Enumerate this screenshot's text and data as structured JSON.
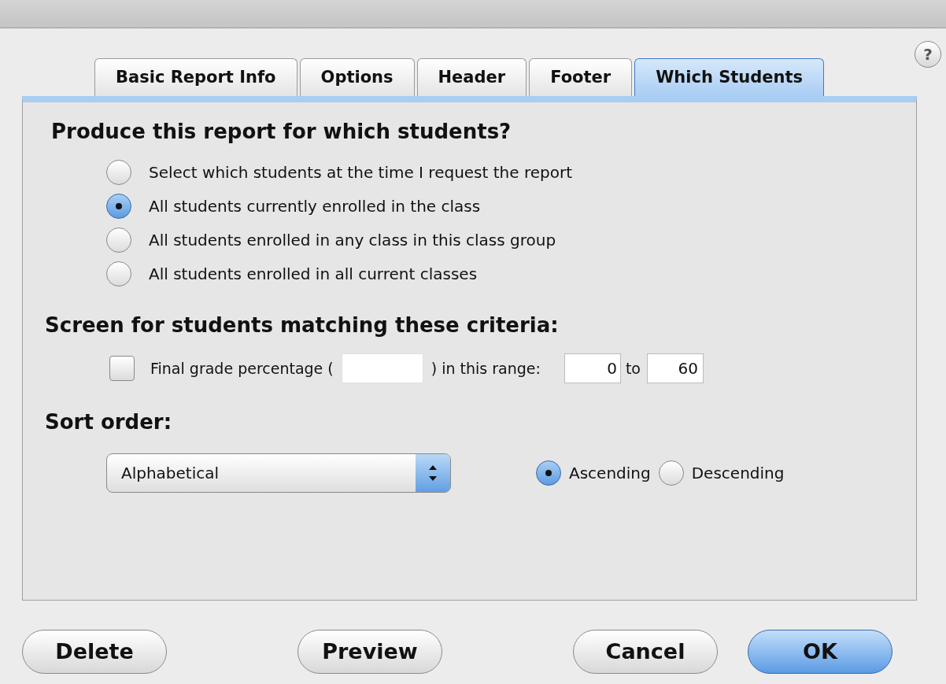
{
  "help_button": {
    "label": "?"
  },
  "tabs": [
    {
      "label": "Basic Report Info",
      "selected": false
    },
    {
      "label": "Options",
      "selected": false
    },
    {
      "label": "Header",
      "selected": false
    },
    {
      "label": "Footer",
      "selected": false
    },
    {
      "label": "Which Students",
      "selected": true
    }
  ],
  "students_section": {
    "heading": "Produce this report for which students?",
    "options": [
      {
        "label": "Select which students at the time I request the report",
        "selected": false
      },
      {
        "label": "All students currently enrolled in the class",
        "selected": true
      },
      {
        "label": "All students enrolled in any class in this class group",
        "selected": false
      },
      {
        "label": "All students enrolled in all current classes",
        "selected": false
      }
    ]
  },
  "criteria_section": {
    "heading": "Screen for students matching these criteria:",
    "checkbox": {
      "label": "Final grade percentage (",
      "checked": false
    },
    "middle_text": ") in this range:",
    "range_from": "0",
    "range_word": "to",
    "range_to": "60"
  },
  "sort_section": {
    "heading": "Sort order:",
    "popup": {
      "value": "Alphabetical"
    },
    "directions": [
      {
        "label": "Ascending",
        "selected": true
      },
      {
        "label": "Descending",
        "selected": false
      }
    ]
  },
  "buttons": [
    {
      "label": "Delete",
      "kind": "plain"
    },
    {
      "label": "Preview",
      "kind": "plain"
    },
    {
      "label": "Cancel",
      "kind": "plain"
    },
    {
      "label": "OK",
      "kind": "default"
    }
  ]
}
